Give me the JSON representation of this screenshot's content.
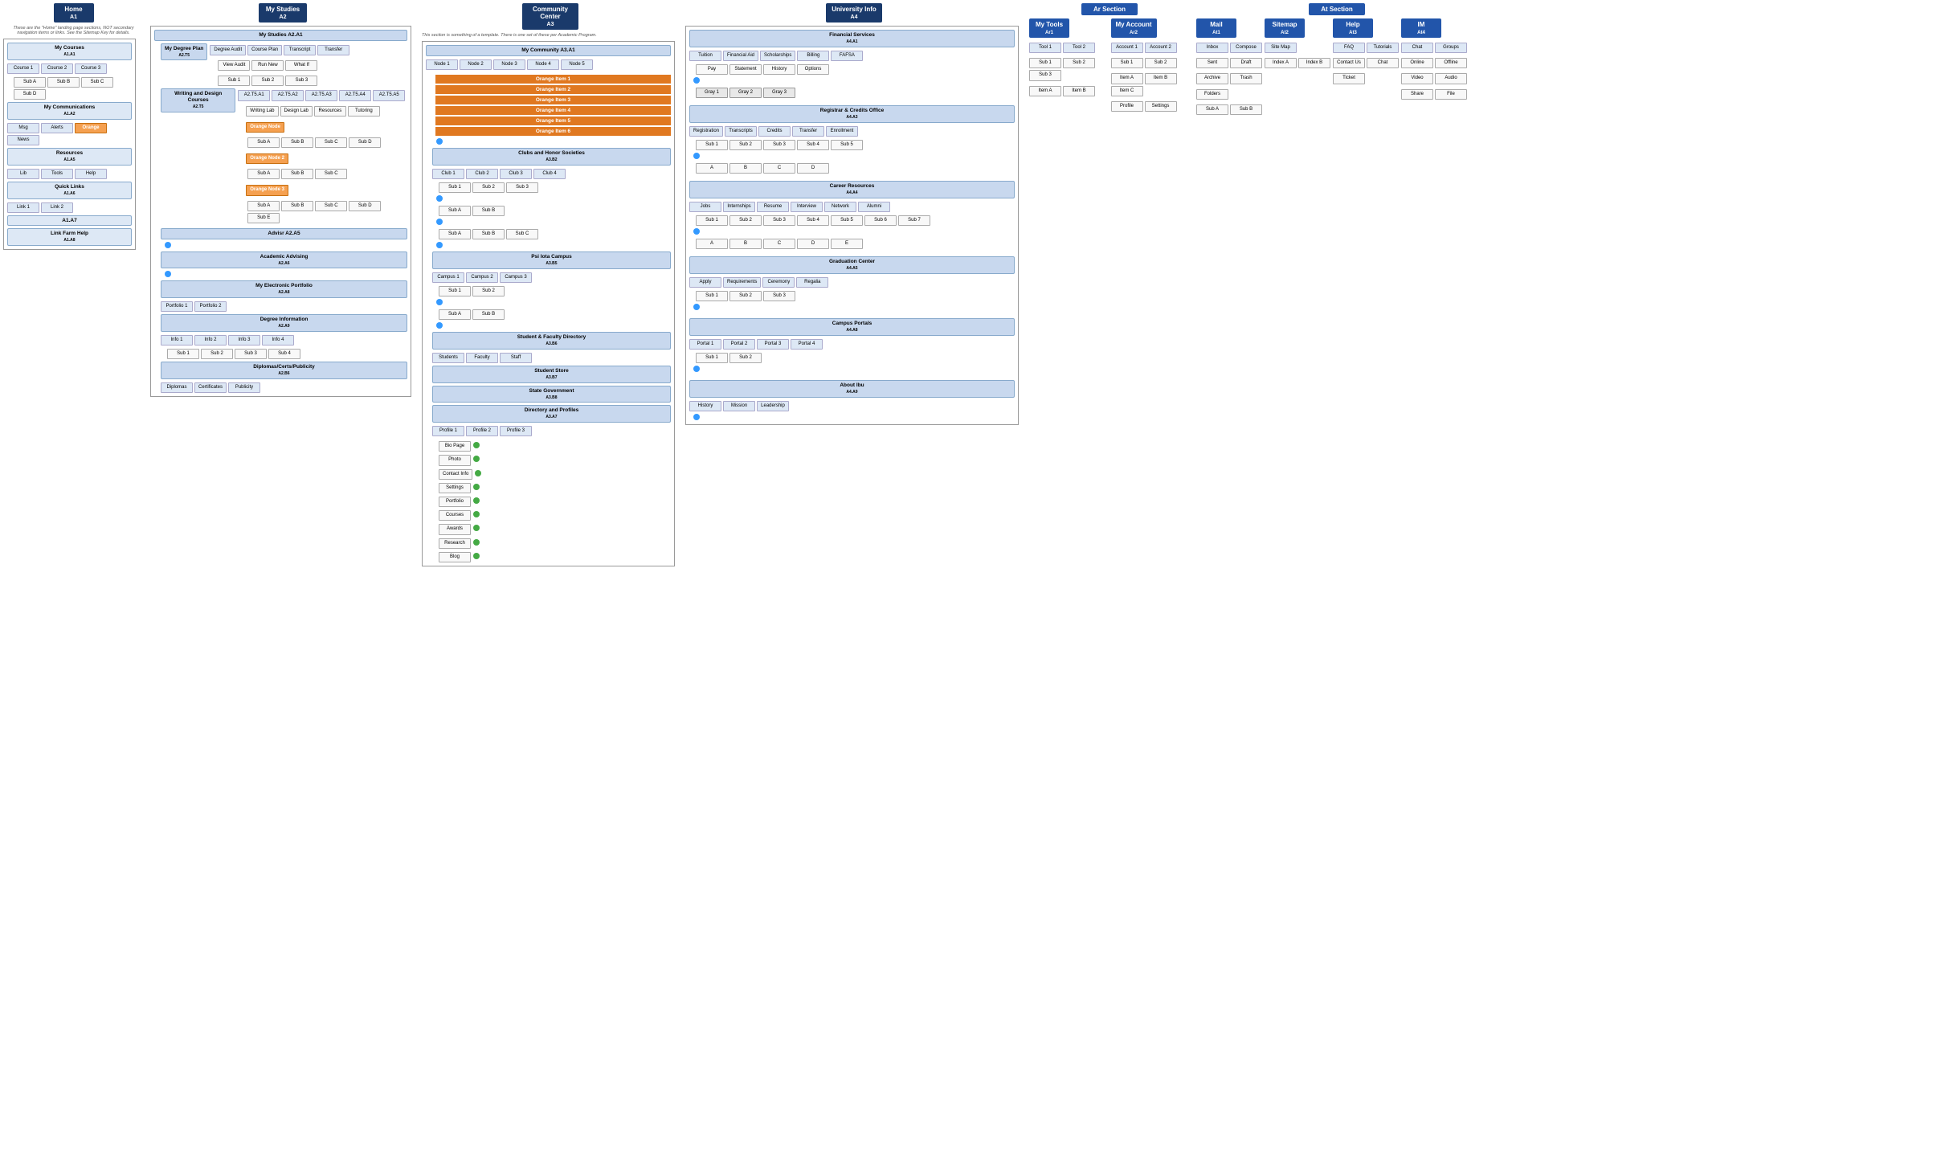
{
  "sections": {
    "home": {
      "title": "Home",
      "code": "A1"
    },
    "myStudies": {
      "title": "My Studies",
      "code": "A2"
    },
    "communityCenter": {
      "title": "Community Center",
      "code": "A3"
    },
    "universityInfo": {
      "title": "University Info",
      "code": "A4"
    },
    "arSection": {
      "title": "Ar Section"
    },
    "atSection": {
      "title": "At Section"
    }
  },
  "arSubSections": [
    {
      "title": "My Tools",
      "code": "Ar1"
    },
    {
      "title": "My Account",
      "code": "Ar2"
    }
  ],
  "atSubSections": [
    {
      "title": "Mail",
      "code": "At1"
    },
    {
      "title": "Sitemap",
      "code": "At2"
    },
    {
      "title": "Help",
      "code": "At3"
    },
    {
      "title": "IM",
      "code": "At4"
    }
  ],
  "note_home": "These are the \"Home\" landing page sections, NOT secondary navigation items or links. See the Sitemap Key for details.",
  "note_community": "This section is something of a template. There is one set of these per Academic Program.",
  "home_nodes": [
    {
      "label": "My Courses\nA1.A1"
    },
    {
      "label": "My Communications\nA1.A2"
    },
    {
      "label": "Resources\nA1.A5"
    },
    {
      "label": "Quick Links\nA1.A6"
    },
    {
      "label": "A1.A7"
    },
    {
      "label": "Link Farm Help\nA1.A8"
    }
  ],
  "myStudies_nodes": [
    {
      "label": "My Studies\nA2.A1"
    },
    {
      "label": "My Degree Plan\nA2.T5"
    },
    {
      "label": "Writing and Design Courses\nA2.T5"
    },
    {
      "label": "Advisr\nA2.A5"
    },
    {
      "label": "Academic Advising\nA2.A6"
    },
    {
      "label": "My Electronic Portfolio\nA2.A8"
    },
    {
      "label": "Degree Information\nA2.A9"
    },
    {
      "label": "Diplomas/Certs/Publicity\nA2.B6"
    }
  ],
  "community_nodes": [
    {
      "label": "My Community\nA3.A1"
    },
    {
      "label": "Clubs and Honor Societies\nA3.B2"
    },
    {
      "label": "Psi Iota Campus\nA3.B5"
    },
    {
      "label": "Student & Faculty Directory\nA3.B6"
    },
    {
      "label": "Student Store\nA3.B7"
    },
    {
      "label": "State Government\nA3.B8"
    },
    {
      "label": "Directory and Profiles\nA3.A7"
    }
  ],
  "university_nodes": [
    {
      "label": "Financial Services\nA4.A1"
    },
    {
      "label": "Registrar & Credits Office\nA4.A3"
    },
    {
      "label": "Career Resources\nA4.A4"
    },
    {
      "label": "Graduation Center\nA4.A5"
    },
    {
      "label": "Campus Portals\nA4.A8"
    },
    {
      "label": "About Ibu\nA4.A9"
    }
  ]
}
